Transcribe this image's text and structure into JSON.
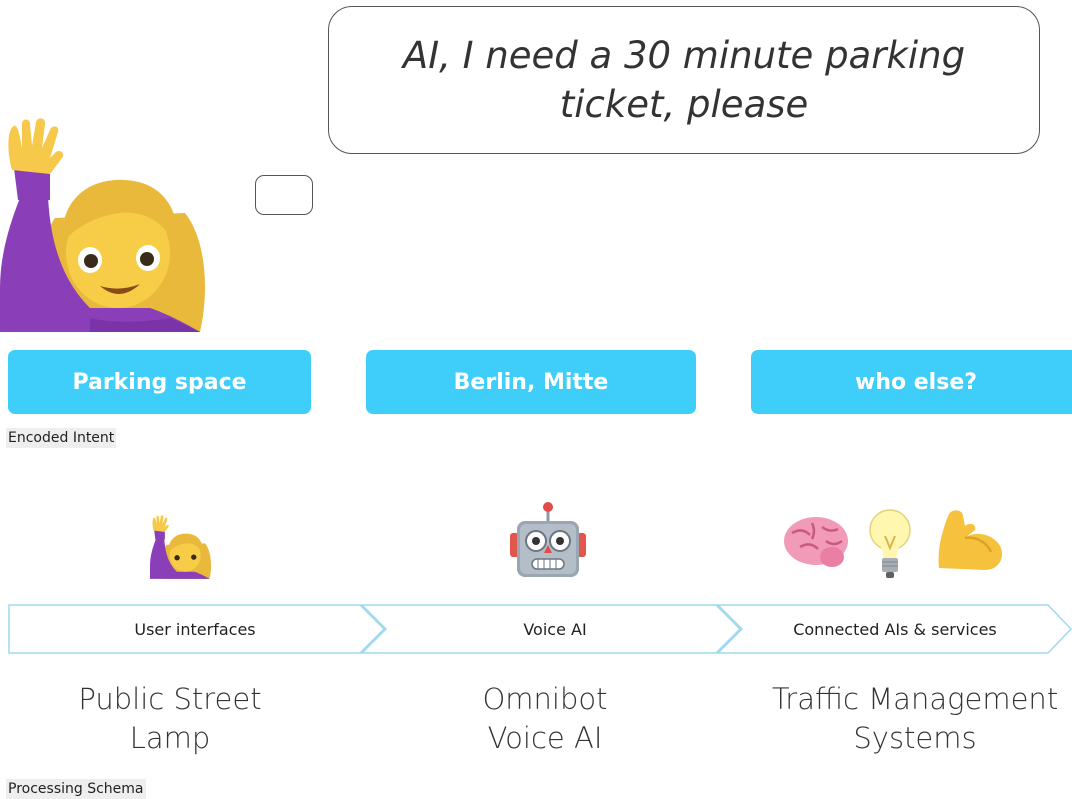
{
  "speech": {
    "line1": "AI, I need a 30 minute parking",
    "line2": "ticket, please"
  },
  "intents": [
    {
      "label": "Parking space"
    },
    {
      "label": "Berlin, Mitte"
    },
    {
      "label": "who else?"
    }
  ],
  "captions": {
    "intent": "Encoded Intent",
    "schema": "Processing Schema"
  },
  "steps": [
    {
      "label": "User interfaces",
      "icons": [
        "person-raising-hand-icon"
      ]
    },
    {
      "label": "Voice AI",
      "icons": [
        "robot-icon"
      ]
    },
    {
      "label": "Connected AIs & services",
      "icons": [
        "brain-icon",
        "light-bulb-icon",
        "flexed-biceps-icon"
      ]
    }
  ],
  "systems": [
    {
      "line1": "Public Street",
      "line2": "Lamp"
    },
    {
      "line1": "Omnibot",
      "line2": "Voice AI"
    },
    {
      "line1": "Traffic Management",
      "line2": "Systems"
    }
  ],
  "colors": {
    "pill": "#3fcdfa",
    "chevron_stroke": "#9fd9ef",
    "caption_bg": "#eeeeee"
  }
}
